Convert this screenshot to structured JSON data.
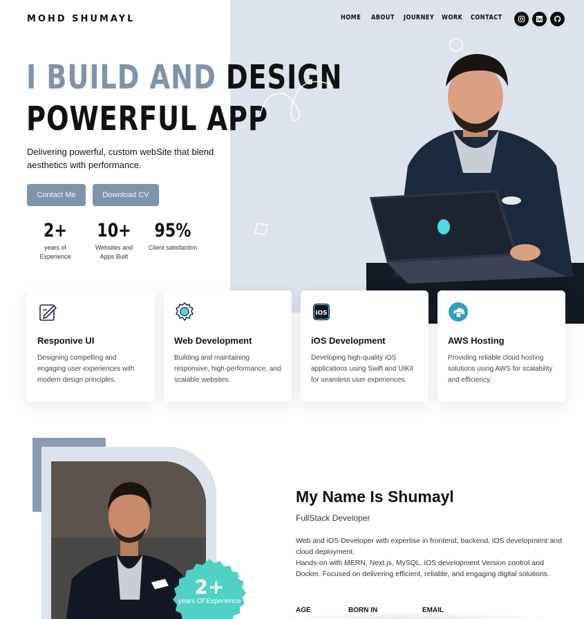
{
  "header": {
    "logo": "MOHD SHUMAYL",
    "nav": [
      "HOME",
      "ABOUT",
      "JOURNEY",
      "WORK",
      "CONTACT"
    ],
    "socials": [
      "instagram-icon",
      "linkedin-icon",
      "github-icon"
    ]
  },
  "hero": {
    "headline_muted": "I BUILD AND",
    "headline_dark1": "DESIGN",
    "headline_dark2": "POWERFUL APP",
    "subtext": "Delivering powerful, custom webSite that blend aesthetics with performance.",
    "contact_button": "Contact Me",
    "cv_button": "Download CV",
    "stats": [
      {
        "value": "2+",
        "label": "years of Experience"
      },
      {
        "value": "10+",
        "label": "Websites and Apps Built"
      },
      {
        "value": "95%",
        "label": "Client satisfaction"
      }
    ]
  },
  "services": [
    {
      "icon": "edit-icon",
      "title": "Responive UI",
      "desc": "Designing compelling and engaging user experiences with modern design principles."
    },
    {
      "icon": "gear-web-icon",
      "title": "Web Development",
      "desc": "Building and maintaining responsive, high-performance, and scalable websites."
    },
    {
      "icon": "ios-icon",
      "title": "iOS Development",
      "desc": "Developing high-quality iOS applications using Swift and UIKit for seamless user experiences."
    },
    {
      "icon": "cloud-hosting-icon",
      "title": "AWS Hosting",
      "desc": "Providing reliable cloud hosting solutions using AWS for scalability and efficiency."
    }
  ],
  "about": {
    "name": "My Name Is Shumayl",
    "role": "FullStack Developer",
    "desc1": "Web and iOS Developer with expertise in frontend, backend, iOS development and cloud deployment.",
    "desc2": "Hands-on with MERN, Next.js, MySQL, iOS development Version control and Docker. Focused on delivering efficient, reliable, and engaging digital solutions.",
    "badge_value": "2+",
    "badge_label": "years Of Experience",
    "labels": [
      "AGE",
      "BORN IN",
      "EMAIL"
    ]
  },
  "colors": {
    "accent": "#7f93ab",
    "hero_bg": "#dde3ec",
    "badge": "#4fd1c5"
  }
}
